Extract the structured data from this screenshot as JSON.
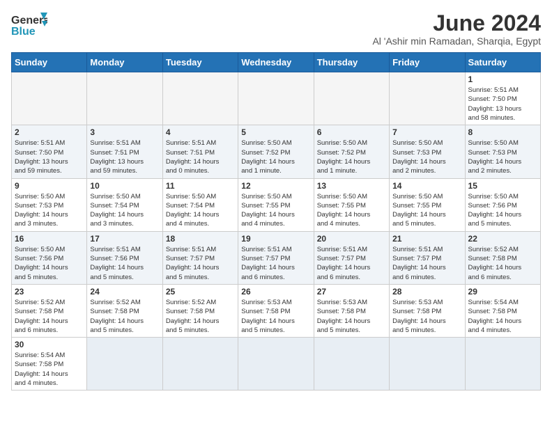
{
  "logo": {
    "line1": "General",
    "line2": "Blue"
  },
  "title": "June 2024",
  "subtitle": "Al 'Ashir min Ramadan, Sharqia, Egypt",
  "days_header": [
    "Sunday",
    "Monday",
    "Tuesday",
    "Wednesday",
    "Thursday",
    "Friday",
    "Saturday"
  ],
  "weeks": [
    [
      {
        "day": "",
        "info": ""
      },
      {
        "day": "",
        "info": ""
      },
      {
        "day": "",
        "info": ""
      },
      {
        "day": "",
        "info": ""
      },
      {
        "day": "",
        "info": ""
      },
      {
        "day": "",
        "info": ""
      },
      {
        "day": "1",
        "info": "Sunrise: 5:51 AM\nSunset: 7:50 PM\nDaylight: 13 hours\nand 58 minutes."
      }
    ],
    [
      {
        "day": "2",
        "info": "Sunrise: 5:51 AM\nSunset: 7:50 PM\nDaylight: 13 hours\nand 59 minutes."
      },
      {
        "day": "3",
        "info": "Sunrise: 5:51 AM\nSunset: 7:51 PM\nDaylight: 13 hours\nand 59 minutes."
      },
      {
        "day": "4",
        "info": "Sunrise: 5:51 AM\nSunset: 7:51 PM\nDaylight: 14 hours\nand 0 minutes."
      },
      {
        "day": "5",
        "info": "Sunrise: 5:50 AM\nSunset: 7:52 PM\nDaylight: 14 hours\nand 1 minute."
      },
      {
        "day": "6",
        "info": "Sunrise: 5:50 AM\nSunset: 7:52 PM\nDaylight: 14 hours\nand 1 minute."
      },
      {
        "day": "7",
        "info": "Sunrise: 5:50 AM\nSunset: 7:53 PM\nDaylight: 14 hours\nand 2 minutes."
      },
      {
        "day": "8",
        "info": "Sunrise: 5:50 AM\nSunset: 7:53 PM\nDaylight: 14 hours\nand 2 minutes."
      }
    ],
    [
      {
        "day": "9",
        "info": "Sunrise: 5:50 AM\nSunset: 7:53 PM\nDaylight: 14 hours\nand 3 minutes."
      },
      {
        "day": "10",
        "info": "Sunrise: 5:50 AM\nSunset: 7:54 PM\nDaylight: 14 hours\nand 3 minutes."
      },
      {
        "day": "11",
        "info": "Sunrise: 5:50 AM\nSunset: 7:54 PM\nDaylight: 14 hours\nand 4 minutes."
      },
      {
        "day": "12",
        "info": "Sunrise: 5:50 AM\nSunset: 7:55 PM\nDaylight: 14 hours\nand 4 minutes."
      },
      {
        "day": "13",
        "info": "Sunrise: 5:50 AM\nSunset: 7:55 PM\nDaylight: 14 hours\nand 4 minutes."
      },
      {
        "day": "14",
        "info": "Sunrise: 5:50 AM\nSunset: 7:55 PM\nDaylight: 14 hours\nand 5 minutes."
      },
      {
        "day": "15",
        "info": "Sunrise: 5:50 AM\nSunset: 7:56 PM\nDaylight: 14 hours\nand 5 minutes."
      }
    ],
    [
      {
        "day": "16",
        "info": "Sunrise: 5:50 AM\nSunset: 7:56 PM\nDaylight: 14 hours\nand 5 minutes."
      },
      {
        "day": "17",
        "info": "Sunrise: 5:51 AM\nSunset: 7:56 PM\nDaylight: 14 hours\nand 5 minutes."
      },
      {
        "day": "18",
        "info": "Sunrise: 5:51 AM\nSunset: 7:57 PM\nDaylight: 14 hours\nand 5 minutes."
      },
      {
        "day": "19",
        "info": "Sunrise: 5:51 AM\nSunset: 7:57 PM\nDaylight: 14 hours\nand 6 minutes."
      },
      {
        "day": "20",
        "info": "Sunrise: 5:51 AM\nSunset: 7:57 PM\nDaylight: 14 hours\nand 6 minutes."
      },
      {
        "day": "21",
        "info": "Sunrise: 5:51 AM\nSunset: 7:57 PM\nDaylight: 14 hours\nand 6 minutes."
      },
      {
        "day": "22",
        "info": "Sunrise: 5:52 AM\nSunset: 7:58 PM\nDaylight: 14 hours\nand 6 minutes."
      }
    ],
    [
      {
        "day": "23",
        "info": "Sunrise: 5:52 AM\nSunset: 7:58 PM\nDaylight: 14 hours\nand 6 minutes."
      },
      {
        "day": "24",
        "info": "Sunrise: 5:52 AM\nSunset: 7:58 PM\nDaylight: 14 hours\nand 5 minutes."
      },
      {
        "day": "25",
        "info": "Sunrise: 5:52 AM\nSunset: 7:58 PM\nDaylight: 14 hours\nand 5 minutes."
      },
      {
        "day": "26",
        "info": "Sunrise: 5:53 AM\nSunset: 7:58 PM\nDaylight: 14 hours\nand 5 minutes."
      },
      {
        "day": "27",
        "info": "Sunrise: 5:53 AM\nSunset: 7:58 PM\nDaylight: 14 hours\nand 5 minutes."
      },
      {
        "day": "28",
        "info": "Sunrise: 5:53 AM\nSunset: 7:58 PM\nDaylight: 14 hours\nand 5 minutes."
      },
      {
        "day": "29",
        "info": "Sunrise: 5:54 AM\nSunset: 7:58 PM\nDaylight: 14 hours\nand 4 minutes."
      }
    ],
    [
      {
        "day": "30",
        "info": "Sunrise: 5:54 AM\nSunset: 7:58 PM\nDaylight: 14 hours\nand 4 minutes."
      },
      {
        "day": "",
        "info": ""
      },
      {
        "day": "",
        "info": ""
      },
      {
        "day": "",
        "info": ""
      },
      {
        "day": "",
        "info": ""
      },
      {
        "day": "",
        "info": ""
      },
      {
        "day": "",
        "info": ""
      }
    ]
  ]
}
